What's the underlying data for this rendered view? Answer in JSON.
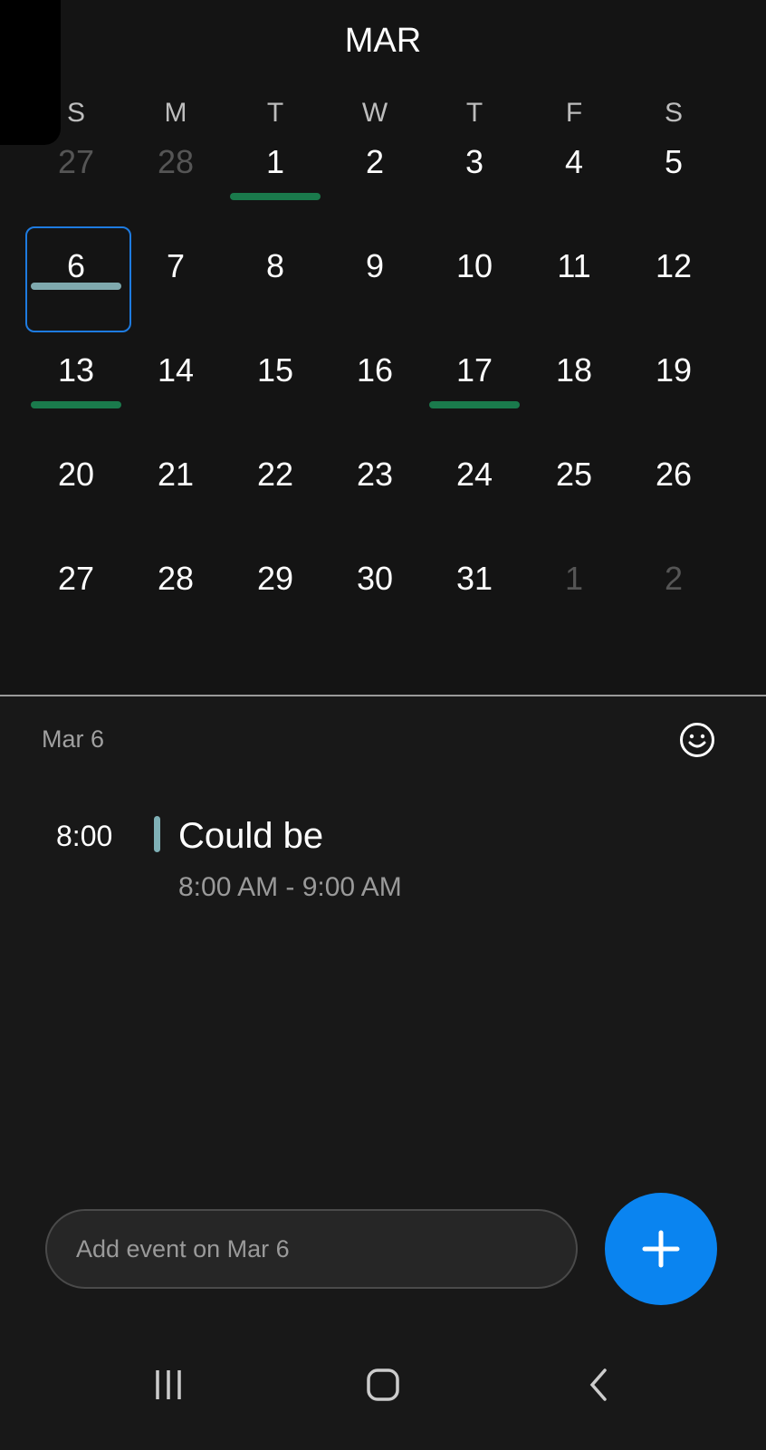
{
  "header": {
    "month": "MAR"
  },
  "calendar": {
    "weekdays": [
      "S",
      "M",
      "T",
      "W",
      "T",
      "F",
      "S"
    ],
    "weeks": [
      [
        {
          "d": "27",
          "o": true
        },
        {
          "d": "28",
          "o": true
        },
        {
          "d": "1",
          "m": "#1a7a4c"
        },
        {
          "d": "2"
        },
        {
          "d": "3"
        },
        {
          "d": "4"
        },
        {
          "d": "5"
        }
      ],
      [
        {
          "d": "6",
          "s": true,
          "m": "#7fa9ae"
        },
        {
          "d": "7"
        },
        {
          "d": "8"
        },
        {
          "d": "9"
        },
        {
          "d": "10"
        },
        {
          "d": "11"
        },
        {
          "d": "12"
        }
      ],
      [
        {
          "d": "13",
          "m": "#1a7a4c"
        },
        {
          "d": "14"
        },
        {
          "d": "15"
        },
        {
          "d": "16"
        },
        {
          "d": "17",
          "m": "#1a7a4c"
        },
        {
          "d": "18"
        },
        {
          "d": "19"
        }
      ],
      [
        {
          "d": "20"
        },
        {
          "d": "21"
        },
        {
          "d": "22"
        },
        {
          "d": "23"
        },
        {
          "d": "24"
        },
        {
          "d": "25"
        },
        {
          "d": "26"
        }
      ],
      [
        {
          "d": "27"
        },
        {
          "d": "28"
        },
        {
          "d": "29"
        },
        {
          "d": "30"
        },
        {
          "d": "31"
        },
        {
          "d": "1",
          "o": true
        },
        {
          "d": "2",
          "o": true
        }
      ]
    ]
  },
  "agenda": {
    "date": "Mar 6",
    "sticker_icon": "smiley-icon",
    "event": {
      "time": "8:00",
      "title": "Could be",
      "range": "8:00 AM - 9:00 AM",
      "color": "#7fb0b6"
    }
  },
  "add_event": {
    "placeholder": "Add event on Mar 6"
  },
  "colors": {
    "accent": "#0a84f0",
    "selection": "#1e7be0"
  }
}
